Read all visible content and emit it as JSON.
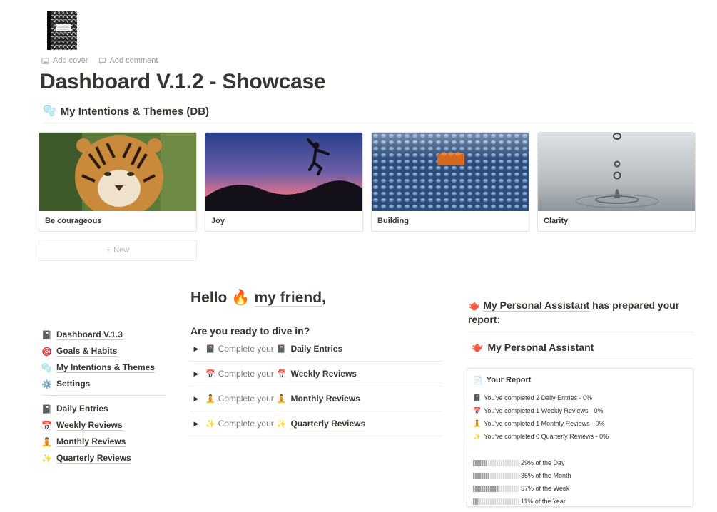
{
  "page": {
    "title": "Dashboard V.1.2 - Showcase",
    "icon": "composition-notebook-icon",
    "add_cover": "Add cover",
    "add_comment": "Add comment"
  },
  "database": {
    "emoji": "🫧",
    "title": "My Intentions & Themes (DB)",
    "cards": [
      {
        "label": "Be courageous",
        "image": "tiger-photo"
      },
      {
        "label": "Joy",
        "image": "jumping-silhouette-sunset-photo"
      },
      {
        "label": "Building",
        "image": "lego-brick-photo"
      },
      {
        "label": "Clarity",
        "image": "water-drop-photo"
      }
    ],
    "new_label": "New"
  },
  "nav": {
    "group1": [
      {
        "icon": "📓",
        "label": "Dashboard V.1.3"
      },
      {
        "icon": "🎯",
        "label": "Goals & Habits"
      },
      {
        "icon": "🫧",
        "label": "My Intentions & Themes"
      },
      {
        "icon": "⚙️",
        "label": "Settings"
      }
    ],
    "group2": [
      {
        "icon": "📓",
        "label": "Daily Entries"
      },
      {
        "icon": "📅",
        "label": "Weekly Reviews"
      },
      {
        "icon": "🧘",
        "label": "Monthly Reviews"
      },
      {
        "icon": "✨",
        "label": "Quarterly Reviews"
      }
    ]
  },
  "greeting": {
    "hello": "Hello",
    "emoji": "🔥",
    "friend": "my friend",
    "comma": ",",
    "ready": "Are you ready to dive in?"
  },
  "toggles": [
    {
      "icon": "📓",
      "prefix": "Complete your",
      "target_icon": "📓",
      "target": "Daily Entries"
    },
    {
      "icon": "📅",
      "prefix": "Complete your",
      "target_icon": "📅",
      "target": "Weekly Reviews"
    },
    {
      "icon": "🧘",
      "prefix": "Complete your",
      "target_icon": "🧘",
      "target": "Monthly Reviews"
    },
    {
      "icon": "✨",
      "prefix": "Complete your",
      "target_icon": "✨",
      "target": "Quarterly Reviews"
    }
  ],
  "assistant": {
    "emoji": "🫖",
    "link": "My Personal Assistant",
    "rest": " has prepared your report:",
    "title": "My Personal Assistant",
    "report_title": "Your Report",
    "report_icon": "📄",
    "lines": [
      {
        "icon": "📓",
        "text": "You've completed 2 Daily Entries - 0%"
      },
      {
        "icon": "📅",
        "text": "You've completed 1 Weekly Reviews - 0%"
      },
      {
        "icon": "🧘",
        "text": "You've completed 1 Monthly Reviews - 0%"
      },
      {
        "icon": "✨",
        "text": "You've completed 0 Quarterly Reviews - 0%"
      }
    ],
    "progress": [
      {
        "label": "29% of the Day",
        "value": 0.29
      },
      {
        "label": "35% of the Month",
        "value": 0.35
      },
      {
        "label": "57% of the Week",
        "value": 0.57
      },
      {
        "label": "11% of the Year",
        "value": 0.11
      }
    ]
  }
}
